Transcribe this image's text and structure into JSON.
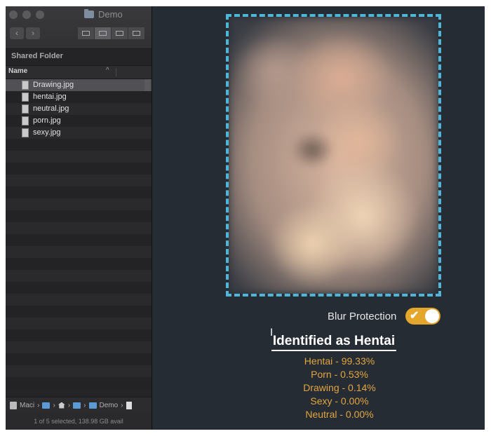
{
  "finder": {
    "window_title": "Demo",
    "back_icon": "chevron-left-icon",
    "forward_icon": "chevron-right-icon",
    "sidebar_section": "Shared Folder",
    "column_name": "Name",
    "sort_icon": "chevron-up-icon",
    "files": [
      {
        "name": "Drawing.jpg",
        "selected": true
      },
      {
        "name": "hentai.jpg",
        "selected": false
      },
      {
        "name": "neutral.jpg",
        "selected": false
      },
      {
        "name": "porn.jpg",
        "selected": false
      },
      {
        "name": "sexy.jpg",
        "selected": false
      }
    ],
    "path": {
      "drive": "Maci",
      "folder": "Demo"
    },
    "status": "1 of 5 selected, 138.98 GB avail"
  },
  "main": {
    "blur_label": "Blur Protection",
    "blur_enabled": true,
    "result_title": "Identified as Hentai",
    "scores": [
      "Hentai - 99.33%",
      "Porn - 0.53%",
      "Drawing - 0.14%",
      "Sexy - 0.00%",
      "Neutral - 0.00%"
    ]
  },
  "colors": {
    "accent_toggle": "#e4a62b",
    "score_text": "#e2a53f",
    "preview_border": "#4fb6d7",
    "main_bg": "#262c34"
  }
}
